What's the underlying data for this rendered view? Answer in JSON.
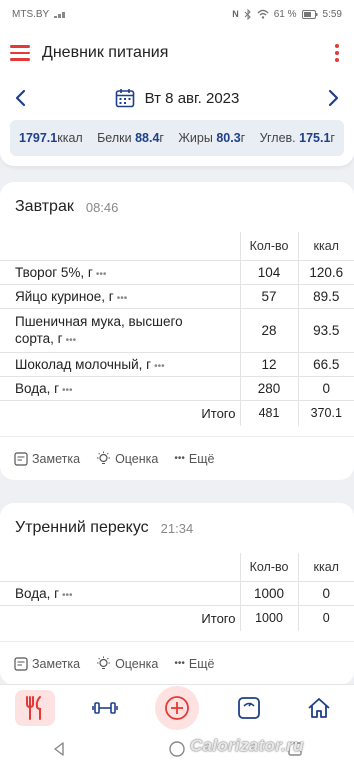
{
  "status_bar": {
    "carrier": "MTS.BY",
    "battery": "61 %",
    "time": "5:59"
  },
  "app_bar": {
    "title": "Дневник питания"
  },
  "date_nav": {
    "date": "Вт 8 авг. 2023"
  },
  "summary": {
    "kcal_value": "1797.1",
    "kcal_unit": "ккал",
    "protein_label": "Белки",
    "protein_value": "88.4",
    "protein_unit": "г",
    "fat_label": "Жиры",
    "fat_value": "80.3",
    "fat_unit": "г",
    "carb_label": "Углев.",
    "carb_value": "175.1",
    "carb_unit": "г"
  },
  "columns": {
    "qty": "Кол-во",
    "kcal": "ккал",
    "total_label": "Итого"
  },
  "meals": [
    {
      "name": "Завтрак",
      "time": "08:46",
      "items": [
        {
          "name": "Творог 5%, г",
          "qty": "104",
          "kcal": "120.6"
        },
        {
          "name": "Яйцо куриное, г",
          "qty": "57",
          "kcal": "89.5"
        },
        {
          "name_line1": "Пшеничная мука, высшего",
          "name_line2": "сорта, г",
          "qty": "28",
          "kcal": "93.5"
        },
        {
          "name": "Шоколад молочный, г",
          "qty": "12",
          "kcal": "66.5"
        },
        {
          "name": "Вода, г",
          "qty": "280",
          "kcal": "0"
        }
      ],
      "total_qty": "481",
      "total_kcal": "370.1"
    },
    {
      "name": "Утренний перекус",
      "time": "21:34",
      "items": [
        {
          "name": "Вода, г",
          "qty": "1000",
          "kcal": "0"
        }
      ],
      "total_qty": "1000",
      "total_kcal": "0"
    }
  ],
  "actions": {
    "note": "Заметка",
    "rating": "Оценка",
    "more": "Ещё"
  },
  "watermark": "Calorizator.ru",
  "colors": {
    "accent": "#e53935",
    "accent_soft": "#fde2e1",
    "navy": "#1e3f8a"
  }
}
